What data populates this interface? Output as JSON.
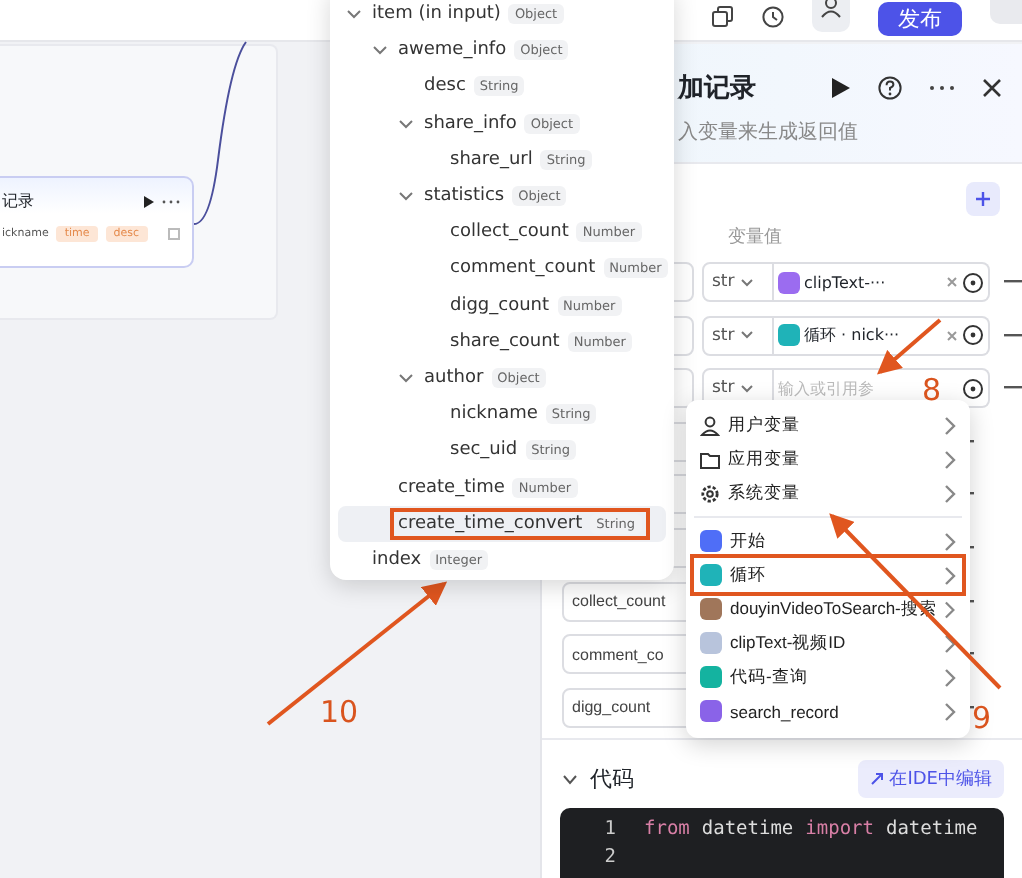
{
  "top_bar": {
    "publish_button": "发布"
  },
  "canvas_node": {
    "title": "记录",
    "param": "ickname",
    "tags": [
      {
        "label": "time"
      },
      {
        "label": "desc"
      }
    ]
  },
  "variable_tree": {
    "items": [
      {
        "label": "item (in input)",
        "type": "Object",
        "expanded": true,
        "selected": false,
        "annotated": false,
        "children": [
          {
            "label": "aweme_info",
            "type": "Object",
            "expanded": true,
            "selected": false,
            "annotated": false,
            "children": [
              {
                "label": "desc",
                "type": "String",
                "selected": false,
                "annotated": false
              },
              {
                "label": "share_info",
                "type": "Object",
                "expanded": true,
                "selected": false,
                "annotated": false,
                "children": [
                  {
                    "label": "share_url",
                    "type": "String",
                    "selected": false,
                    "annotated": false
                  }
                ]
              },
              {
                "label": "statistics",
                "type": "Object",
                "expanded": true,
                "selected": false,
                "annotated": false,
                "children": [
                  {
                    "label": "collect_count",
                    "type": "Number",
                    "selected": false,
                    "annotated": false
                  },
                  {
                    "label": "comment_count",
                    "type": "Number",
                    "selected": false,
                    "annotated": false
                  },
                  {
                    "label": "digg_count",
                    "type": "Number",
                    "selected": false,
                    "annotated": false
                  },
                  {
                    "label": "share_count",
                    "type": "Number",
                    "selected": false,
                    "annotated": false
                  }
                ]
              },
              {
                "label": "author",
                "type": "Object",
                "expanded": true,
                "selected": false,
                "annotated": false,
                "children": [
                  {
                    "label": "nickname",
                    "type": "String",
                    "selected": false,
                    "annotated": false
                  },
                  {
                    "label": "sec_uid",
                    "type": "String",
                    "selected": false,
                    "annotated": false
                  }
                ]
              }
            ]
          },
          {
            "label": "create_time",
            "type": "Number",
            "selected": false,
            "annotated": false
          },
          {
            "label": "create_time_convert",
            "type": "String",
            "selected": true,
            "annotated": true
          }
        ]
      },
      {
        "label": "index",
        "type": "Integer",
        "selected": false,
        "annotated": false
      }
    ]
  },
  "panel": {
    "title": "加记录",
    "subtitle": "入变量来生成返回值",
    "value_header": "变量值",
    "rows": [
      {
        "type": "str",
        "kind": "reference",
        "value": "clipText-···",
        "color": "#9b6cf0"
      },
      {
        "type": "str",
        "kind": "reference",
        "value": "循环 · nick···",
        "color": "#1fb3b8"
      },
      {
        "type": "str",
        "kind": "empty",
        "placeholder": "输入或引用参"
      },
      {
        "kind": "hidden"
      },
      {
        "kind": "hidden"
      },
      {
        "kind": "hidden"
      },
      {
        "name": "collect_count",
        "kind": "hidden"
      },
      {
        "name": "comment_co",
        "kind": "hidden"
      },
      {
        "name": "digg_count",
        "kind": "hidden"
      }
    ]
  },
  "menu": {
    "items": [
      {
        "kind": "user",
        "label": "用户变量",
        "annotated": false
      },
      {
        "kind": "app",
        "label": "应用变量",
        "annotated": false
      },
      {
        "kind": "system",
        "label": "系统变量",
        "annotated": false
      },
      {
        "kind": "node",
        "label": "开始",
        "color": "#4f6ef7",
        "annotated": false
      },
      {
        "kind": "node",
        "label": "循环",
        "color": "#1fb3b8",
        "annotated": true
      },
      {
        "kind": "node",
        "label": "douyinVideoToSearch-搜索",
        "color": "#a0765a",
        "annotated": false
      },
      {
        "kind": "node",
        "label": "clipText-视频ID",
        "color": "#b8c4dc",
        "annotated": false
      },
      {
        "kind": "node",
        "label": "代码-查询",
        "color": "#14b3a0",
        "annotated": false
      },
      {
        "kind": "node",
        "label": "search_record",
        "color": "#8a63e8",
        "annotated": false
      }
    ]
  },
  "code": {
    "title": "代码",
    "edit_button": "在IDE中编辑",
    "lines": [
      {
        "number": "1",
        "tokens": [
          {
            "text": "from",
            "kind": "keyword"
          },
          {
            "text": "datetime",
            "kind": "plain"
          },
          {
            "text": "import",
            "kind": "keyword"
          },
          {
            "text": "datetime",
            "kind": "plain"
          }
        ]
      },
      {
        "number": "2"
      }
    ]
  },
  "annotations": [
    {
      "label": "8"
    },
    {
      "label": "9"
    },
    {
      "label": "10"
    }
  ]
}
